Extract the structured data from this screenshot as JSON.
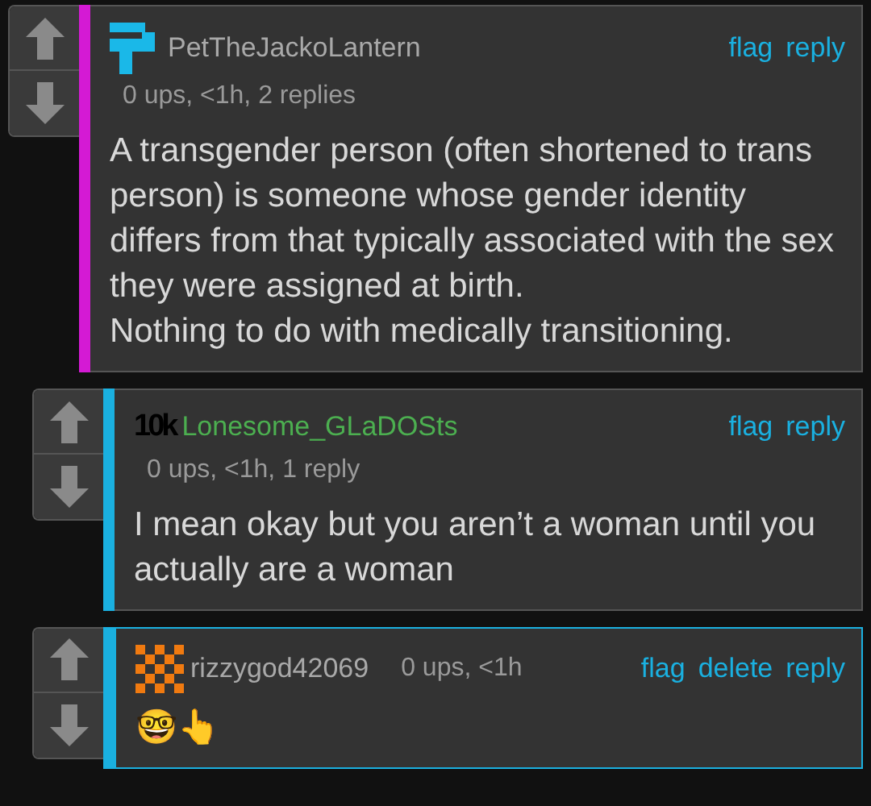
{
  "comments": [
    {
      "kind": "full",
      "avatar": {
        "kind": "logo"
      },
      "username": "PetTheJackoLantern",
      "color": "#d41ad4",
      "highlighted": false,
      "meta": "0 ups, <1h, 2 replies",
      "actions": [
        "flag",
        "reply"
      ],
      "body": [
        "A transgender person (often shortened to trans person) is someone whose gender identity differs from that typically associated with the sex they were assigned at birth.",
        "Nothing to do with medically transitioning."
      ],
      "children": [
        {
          "kind": "full",
          "avatar": {
            "kind": "badge",
            "text": "10k"
          },
          "username": "Lonesome_GLaDOSts",
          "color": "#1ab0e0",
          "highlighted": false,
          "meta": "0 ups, <1h, 1 reply",
          "actions": [
            "flag",
            "reply"
          ],
          "body": [
            "I mean okay but you aren’t a woman until you actually are a woman"
          ]
        },
        {
          "kind": "compact",
          "avatar": {
            "kind": "checker"
          },
          "username": "rizzygod42069",
          "color": "#1ab0e0",
          "highlighted": true,
          "meta": "0 ups, <1h",
          "actions": [
            "flag",
            "delete",
            "reply"
          ],
          "body": [
            "🤓👆"
          ]
        }
      ]
    }
  ]
}
